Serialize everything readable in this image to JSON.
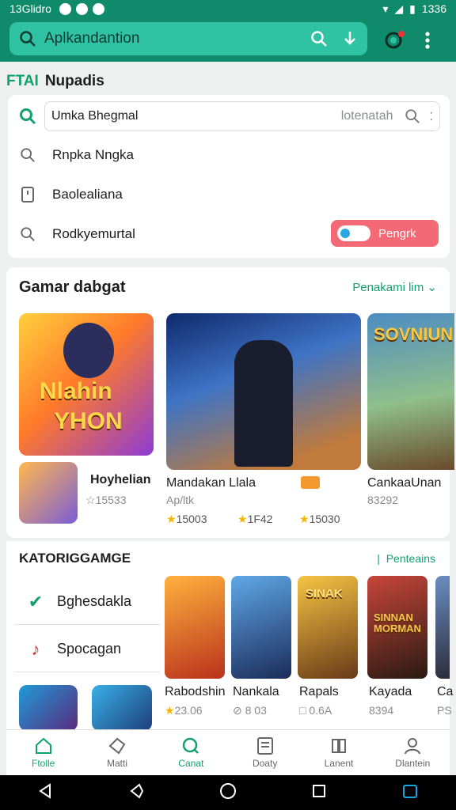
{
  "status": {
    "left": "13Glidro",
    "time": "1336"
  },
  "appbar": {
    "search_text": "Aplkandantion"
  },
  "subheader": {
    "brand": "FTAI",
    "title": "Nupadis"
  },
  "suggestions": {
    "input_value": "Umka Bhegmal",
    "input_hint": "lotenatah",
    "items": [
      "Rnpka Nngka",
      "Baolealiana",
      "Rodkyemurtal"
    ],
    "pill_label": "Pengrk"
  },
  "section1": {
    "title": "Gamar dabgat",
    "link": "Penakami lim",
    "featured": {
      "tile_text_1": "Nlahin",
      "tile_text_2": "YHON",
      "name": "Hoyhelian",
      "rating": "15533"
    },
    "cards": [
      {
        "name": "Mandakan Llala",
        "sub": "Ap/ltk",
        "rating1": "15003",
        "rating2": "1F42",
        "rating3": "15030"
      },
      {
        "name": "CankaaUnan",
        "sub": "83292",
        "tile_text": "SOVNIUN"
      }
    ]
  },
  "section2": {
    "title": "KATORIGGAMGE",
    "link": "Penteains",
    "categories": [
      {
        "label": "Bghesdakla",
        "icon": "check-icon"
      },
      {
        "label": "Spocagan",
        "icon": "music-icon"
      }
    ],
    "games": [
      {
        "name": "Rabodshin",
        "meta": "23.06"
      },
      {
        "name": "Nankala",
        "meta": "8 03"
      },
      {
        "name": "Rapals",
        "meta": "0.6A",
        "tile_text": "SINAK"
      },
      {
        "name": "Kayada",
        "meta": "8394",
        "tile_text": "SINNAN MORMAN"
      },
      {
        "name": "Ca",
        "meta": "PS"
      }
    ]
  },
  "bottom_nav": [
    {
      "label": "Ftolle",
      "icon": "home-icon"
    },
    {
      "label": "Matti",
      "icon": "tag-icon"
    },
    {
      "label": "Canat",
      "icon": "search-icon"
    },
    {
      "label": "Doaty",
      "icon": "list-icon"
    },
    {
      "label": "Lanent",
      "icon": "book-icon"
    },
    {
      "label": "Dlantein",
      "icon": "person-icon"
    }
  ],
  "colors": {
    "primary": "#0f8a6a",
    "accent": "#13a06f",
    "pill": "#f36a76"
  }
}
